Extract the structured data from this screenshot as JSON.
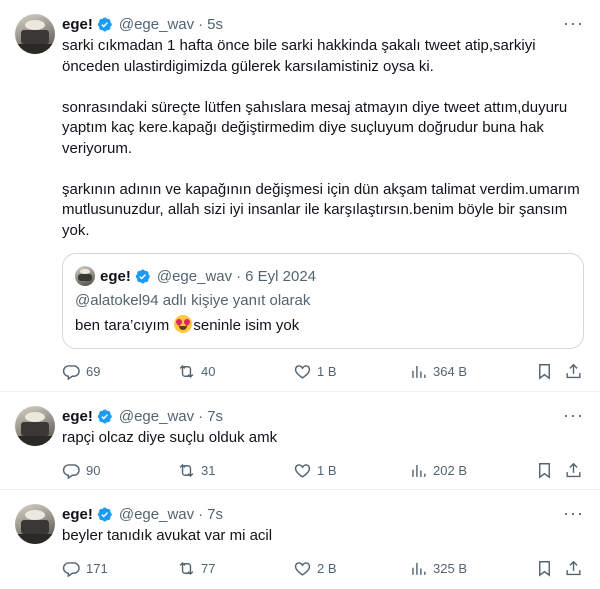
{
  "tweets": [
    {
      "name": "ege!",
      "handle": "@ege_wav",
      "sep": "·",
      "time": "5s",
      "text": "sarki cıkmadan 1 hafta önce bile sarki hakkinda şakalı tweet atip,sarkiyi önceden ulastirdigimizda gülerek karsılamistiniz oysa ki.\n\nsonrasındaki süreçte lütfen şahıslara mesaj atmayın diye tweet attım,duyuru yaptım kaç kere.kapağı değiştirmedim diye suçluyum doğrudur buna hak veriyorum.\n\nşarkının adının ve kapağının değişmesi için dün akşam talimat verdim.umarım mutlusunuzdur, allah sizi iyi insanlar ile karşılaştırsın.benim böyle bir şansım yok.",
      "quote": {
        "name": "ege!",
        "handle": "@ege_wav",
        "sep": "·",
        "date": "6 Eyl 2024",
        "reply_to": "@alatokel94 adlı kişiye yanıt olarak",
        "text_before": "ben tara’cıyım ",
        "emoji": "smiling-face-with-heart-eyes",
        "text_after": "seninle isim yok"
      },
      "replies": "69",
      "retweets": "40",
      "likes": "1 B",
      "views": "364 B"
    },
    {
      "name": "ege!",
      "handle": "@ege_wav",
      "sep": "·",
      "time": "7s",
      "text": "rapçi olcaz diye suçlu olduk amk",
      "replies": "90",
      "retweets": "31",
      "likes": "1 B",
      "views": "202 B"
    },
    {
      "name": "ege!",
      "handle": "@ege_wav",
      "sep": "·",
      "time": "7s",
      "text": "beyler tanıdık avukat var mi acil",
      "replies": "171",
      "retweets": "77",
      "likes": "2 B",
      "views": "325 B"
    }
  ],
  "more_glyph": "···",
  "colors": {
    "verified": "#1d9bf0",
    "secondary": "#536471",
    "text": "#0f1419",
    "border": "#eff3f4"
  },
  "icons": [
    "reply-icon",
    "retweet-icon",
    "like-icon",
    "views-icon",
    "bookmark-icon",
    "share-icon",
    "verified-badge-icon",
    "more-icon"
  ]
}
